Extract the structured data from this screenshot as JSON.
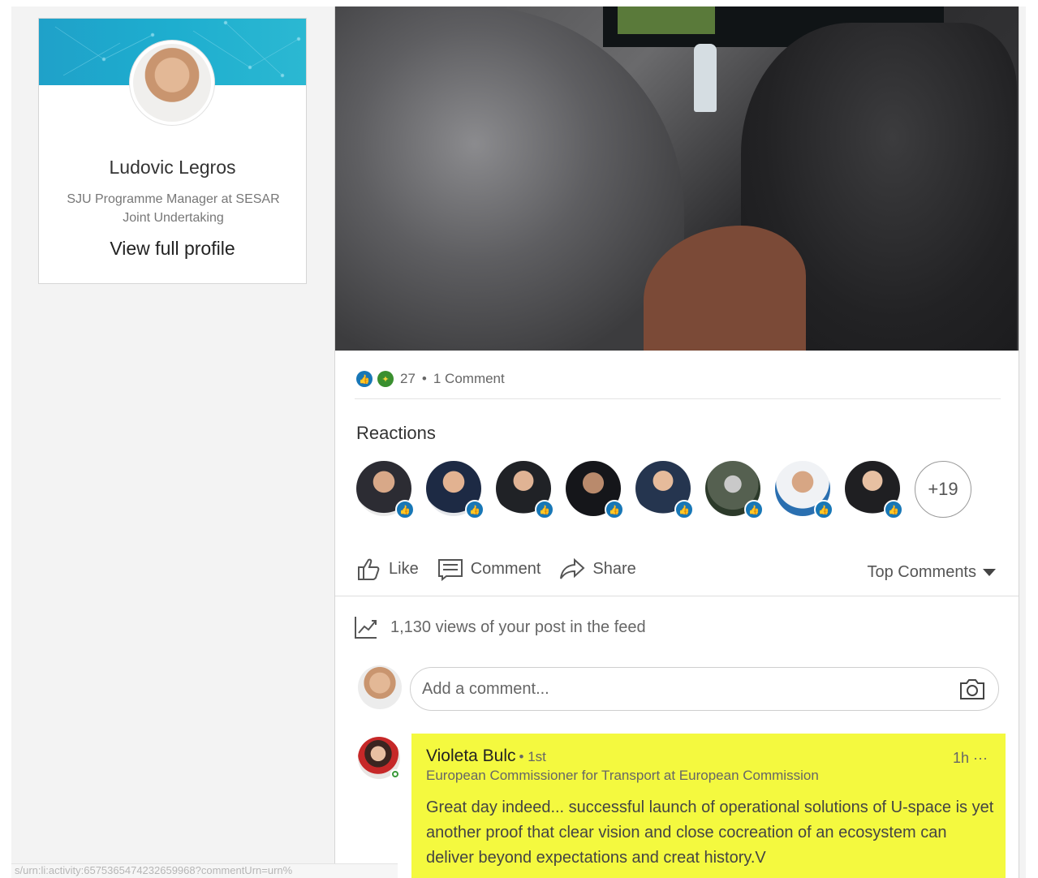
{
  "profile": {
    "name": "Ludovic Legros",
    "headline": "SJU Programme Manager at SESAR Joint Undertaking",
    "view_profile": "View full profile"
  },
  "post": {
    "reaction_count": "27",
    "separator": "•",
    "comment_count": "1 Comment",
    "reactions_title": "Reactions",
    "reactor_icons": [
      "avatar",
      "avatar",
      "avatar",
      "avatar",
      "avatar",
      "avatar",
      "avatar",
      "avatar"
    ],
    "more_reactors": "+19",
    "actions": {
      "like": "Like",
      "comment": "Comment",
      "share": "Share"
    },
    "sort_label": "Top Comments",
    "views_text": "1,130 views of your post in the feed",
    "comment_placeholder": "Add a comment..."
  },
  "comment": {
    "author": "Violeta Bulc",
    "degree": "• 1st",
    "time": "1h",
    "menu": "···",
    "headline": "European Commissioner for Transport at European Commission",
    "text": "Great day indeed... successful launch of operational solutions of U-space is yet another proof that clear vision and close cocreation of an ecosystem can deliver beyond expectations and creat history.V"
  },
  "status_bar": {
    "url": "s/urn:li:activity:6575365474232659968?commentUrn=urn%"
  },
  "colors": {
    "accent": "#1877b6",
    "highlight": "#f4f93f",
    "banner": "#1fa1c9"
  }
}
